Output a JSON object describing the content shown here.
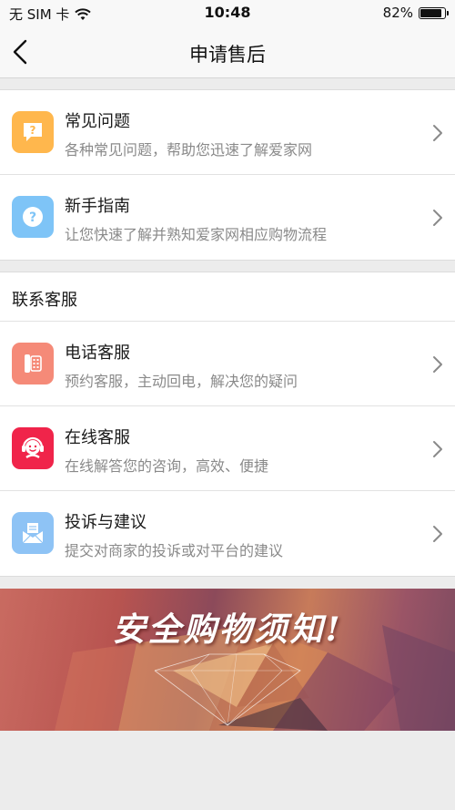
{
  "status_bar": {
    "carrier": "无 SIM 卡",
    "time": "10:48",
    "battery": "82%",
    "battery_level": 0.82
  },
  "nav": {
    "title": "申请售后"
  },
  "help": {
    "items": [
      {
        "title": "常见问题",
        "desc": "各种常见问题，帮助您迅速了解爱家网",
        "icon": "chat-question-icon",
        "color": "#ffb74d"
      },
      {
        "title": "新手指南",
        "desc": "让您快速了解并熟知爱家网相应购物流程",
        "icon": "question-circle-icon",
        "color": "#7ec4f7"
      }
    ]
  },
  "contact": {
    "header": "联系客服",
    "items": [
      {
        "title": "电话客服",
        "desc": "预约客服，主动回电，解决您的疑问",
        "icon": "phone-icon",
        "color": "#f58a78"
      },
      {
        "title": "在线客服",
        "desc": "在线解答您的咨询，高效、便捷",
        "icon": "headset-agent-icon",
        "color": "#f0244a"
      },
      {
        "title": "投诉与建议",
        "desc": "提交对商家的投诉或对平台的建议",
        "icon": "mail-envelope-icon",
        "color": "#8ec3f5"
      }
    ]
  },
  "banner": {
    "text": "安全购物须知!"
  }
}
